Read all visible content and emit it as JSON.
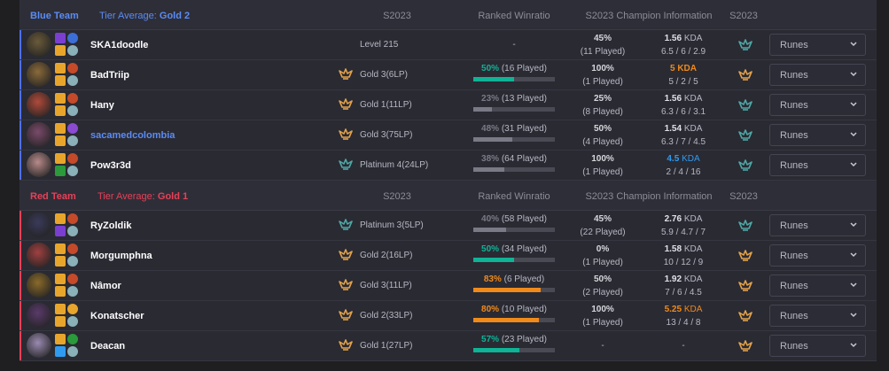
{
  "columns": {
    "season": "S2023",
    "ranked_winratio": "Ranked Winratio",
    "champion_info": "S2023 Champion Information",
    "season2": "S2023"
  },
  "colors": {
    "blue_team": "#5b8cf4",
    "red_team": "#e84057",
    "gold_tier": "#e2a24a",
    "platinum_tier": "#4ea8a5",
    "win_teal": "#0fb396",
    "win_orange": "#f08a1a",
    "kda_orange": "#f08a1a",
    "kda_blue": "#2f9bf0"
  },
  "teams": [
    {
      "name": "Blue Team",
      "tier_label": "Tier Average:",
      "tier_value": "Gold 2",
      "color": "#5b8cf4",
      "players": [
        {
          "name": "SKA1doodle",
          "highlight": false,
          "champ_color": "#6a5a3a",
          "spells": [
            "#7a3fd1",
            "#e8a52b"
          ],
          "runes": [
            "#3b6fd6",
            "#8ab0b8"
          ],
          "tier_icon": "none",
          "rank": "Level 215",
          "rank_only": true,
          "wr_text": "-",
          "wr_pct": "",
          "wr_played": "",
          "wr_fraction": null,
          "wr_color": "",
          "champ_wr": "45%",
          "champ_played": "(11 Played)",
          "kda": "1.56",
          "kda_label": "KDA",
          "kda_color": "",
          "kda_line": "6.5 / 6 / 2.9",
          "s_tier": "platinum"
        },
        {
          "name": "BadTriip",
          "highlight": false,
          "champ_color": "#8a6a3a",
          "spells": [
            "#e8a52b",
            "#e8a52b"
          ],
          "runes": [
            "#c44a2a",
            "#8ab0b8"
          ],
          "tier_icon": "gold",
          "rank": "Gold 3(6LP)",
          "rank_only": false,
          "wr_text": "",
          "wr_pct": "50%",
          "wr_played": "(16 Played)",
          "wr_fraction": 0.5,
          "wr_color": "#0fb396",
          "champ_wr": "100%",
          "champ_played": "(1 Played)",
          "kda": "5 KDA",
          "kda_label": "",
          "kda_color": "#f08a1a",
          "kda_line": "5 / 2 / 5",
          "s_tier": "gold"
        },
        {
          "name": "Hany",
          "highlight": false,
          "champ_color": "#b04a3a",
          "spells": [
            "#e8a52b",
            "#e8a52b"
          ],
          "runes": [
            "#c44a2a",
            "#8ab0b8"
          ],
          "tier_icon": "gold",
          "rank": "Gold 1(11LP)",
          "rank_only": false,
          "wr_text": "",
          "wr_pct": "23%",
          "wr_played": "(13 Played)",
          "wr_fraction": 0.23,
          "wr_color": "#7a7a86",
          "champ_wr": "25%",
          "champ_played": "(8 Played)",
          "kda": "1.56",
          "kda_label": "KDA",
          "kda_color": "",
          "kda_line": "6.3 / 6 / 3.1",
          "s_tier": "platinum"
        },
        {
          "name": "sacamedcolombia",
          "highlight": true,
          "champ_color": "#7a4a6a",
          "spells": [
            "#e8a52b",
            "#e8a52b"
          ],
          "runes": [
            "#8a4ad1",
            "#8ab0b8"
          ],
          "tier_icon": "gold",
          "rank": "Gold 3(75LP)",
          "rank_only": false,
          "wr_text": "",
          "wr_pct": "48%",
          "wr_played": "(31 Played)",
          "wr_fraction": 0.48,
          "wr_color": "#7a7a86",
          "champ_wr": "50%",
          "champ_played": "(4 Played)",
          "kda": "1.54",
          "kda_label": "KDA",
          "kda_color": "",
          "kda_line": "6.3 / 7 / 4.5",
          "s_tier": "platinum"
        },
        {
          "name": "Pow3r3d",
          "highlight": false,
          "champ_color": "#b88a8a",
          "spells": [
            "#e8a52b",
            "#2a9a3a"
          ],
          "runes": [
            "#c44a2a",
            "#8ab0b8"
          ],
          "tier_icon": "platinum",
          "rank": "Platinum 4(24LP)",
          "rank_only": false,
          "wr_text": "",
          "wr_pct": "38%",
          "wr_played": "(64 Played)",
          "wr_fraction": 0.38,
          "wr_color": "#7a7a86",
          "champ_wr": "100%",
          "champ_played": "(1 Played)",
          "kda": "4.5",
          "kda_label": "KDA",
          "kda_color": "#2f9bf0",
          "kda_line": "2 / 4 / 16",
          "s_tier": "platinum"
        }
      ]
    },
    {
      "name": "Red Team",
      "tier_label": "Tier Average:",
      "tier_value": "Gold 1",
      "color": "#e84057",
      "players": [
        {
          "name": "RyZoldik",
          "highlight": false,
          "champ_color": "#3a3a5a",
          "spells": [
            "#e8a52b",
            "#7a3fd1"
          ],
          "runes": [
            "#c44a2a",
            "#8ab0b8"
          ],
          "tier_icon": "platinum",
          "rank": "Platinum 3(5LP)",
          "rank_only": false,
          "wr_text": "",
          "wr_pct": "40%",
          "wr_played": "(58 Played)",
          "wr_fraction": 0.4,
          "wr_color": "#7a7a86",
          "champ_wr": "45%",
          "champ_played": "(22 Played)",
          "kda": "2.76",
          "kda_label": "KDA",
          "kda_color": "",
          "kda_line": "5.9 / 4.7 / 7",
          "s_tier": "platinum"
        },
        {
          "name": "Morgumphna",
          "highlight": false,
          "champ_color": "#a04040",
          "spells": [
            "#e8a52b",
            "#e8a52b"
          ],
          "runes": [
            "#c44a2a",
            "#8ab0b8"
          ],
          "tier_icon": "gold",
          "rank": "Gold 2(16LP)",
          "rank_only": false,
          "wr_text": "",
          "wr_pct": "50%",
          "wr_played": "(34 Played)",
          "wr_fraction": 0.5,
          "wr_color": "#0fb396",
          "champ_wr": "0%",
          "champ_played": "(1 Played)",
          "kda": "1.58",
          "kda_label": "KDA",
          "kda_color": "",
          "kda_line": "10 / 12 / 9",
          "s_tier": "gold"
        },
        {
          "name": "Nâmor",
          "highlight": false,
          "champ_color": "#8a6a2a",
          "spells": [
            "#e8a52b",
            "#e8a52b"
          ],
          "runes": [
            "#c44a2a",
            "#8ab0b8"
          ],
          "tier_icon": "gold",
          "rank": "Gold 3(11LP)",
          "rank_only": false,
          "wr_text": "",
          "wr_pct": "83%",
          "wr_played": "(6 Played)",
          "wr_fraction": 0.83,
          "wr_color": "#f08a1a",
          "champ_wr": "50%",
          "champ_played": "(2 Played)",
          "kda": "1.92",
          "kda_label": "KDA",
          "kda_color": "",
          "kda_line": "7 / 6 / 4.5",
          "s_tier": "gold"
        },
        {
          "name": "Konatscher",
          "highlight": false,
          "champ_color": "#5a3a6a",
          "spells": [
            "#e8a52b",
            "#e8a52b"
          ],
          "runes": [
            "#e8a52b",
            "#8ab0b8"
          ],
          "tier_icon": "gold",
          "rank": "Gold 2(33LP)",
          "rank_only": false,
          "wr_text": "",
          "wr_pct": "80%",
          "wr_played": "(10 Played)",
          "wr_fraction": 0.8,
          "wr_color": "#f08a1a",
          "champ_wr": "100%",
          "champ_played": "(1 Played)",
          "kda": "5.25",
          "kda_label": "KDA",
          "kda_color": "#f08a1a",
          "kda_line": "13 / 4 / 8",
          "s_tier": "gold"
        },
        {
          "name": "Deacan",
          "highlight": false,
          "champ_color": "#9a8ab0",
          "spells": [
            "#e8a52b",
            "#2f9bf0"
          ],
          "runes": [
            "#2a9a3a",
            "#8ab0b8"
          ],
          "tier_icon": "gold",
          "rank": "Gold 1(27LP)",
          "rank_only": false,
          "wr_text": "",
          "wr_pct": "57%",
          "wr_played": "(23 Played)",
          "wr_fraction": 0.57,
          "wr_color": "#0fb396",
          "champ_wr": "-",
          "champ_played": "",
          "kda": "-",
          "kda_label": "",
          "kda_color": "",
          "kda_line": "",
          "s_tier": "gold"
        }
      ]
    }
  ],
  "runes_button_label": "Runes",
  "runes_icon": "chevron-down-icon"
}
